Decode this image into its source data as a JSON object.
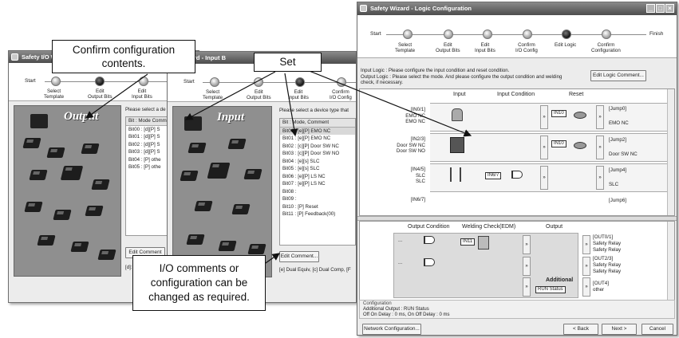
{
  "left_window": {
    "title": "Safety I/O Wi",
    "start": "Start",
    "steps": [
      "Select\nTemplate",
      "Edit\nOutput Bits",
      "Edit\nInput Bits"
    ],
    "image_title": "Output",
    "prompt": "Please select a de",
    "list_header": "Bit : Mode Comm",
    "items": [
      "Bit00 : [d][P] S",
      "Bit01 : [d][P] S",
      "Bit02 : [d][P] S",
      "Bit03 : [d][P] S",
      "Bit04 : [P] othe",
      "Bit05 : [P] othe"
    ],
    "edit_comment": "Edit Comment",
    "legend": "[d]: S"
  },
  "mid_window": {
    "title": "Wizard - Input B",
    "start": "Start",
    "steps": [
      "Select\nTemplate",
      "Edit\nOutput Bits",
      "Edit\nInput Bits",
      "Confirm\nI/O Config"
    ],
    "image_title": "Input",
    "prompt": "Please select a device type that",
    "list_header": "Bit : Mode, Comment",
    "items": [
      "Bit00 : [e][P] EMO NC",
      "Bit01 : [e][P] EMO NC",
      "Bit02 : [c][P] Door SW NC",
      "Bit03 : [c][P] Door SW NO",
      "Bit04 : [e][s] SLC",
      "Bit05 : [e][s] SLC",
      "Bit06 : [e][P] LS NC",
      "Bit07 : [e][P] LS NC",
      "Bit08 :",
      "Bit09 :",
      "Bit10 : [P] Reset",
      "Bit11 : [P] Feedback(00)"
    ],
    "edit_comment": "Edit Comment...",
    "legend": "[e] Dual Equiv, [c] Dual Comp, [F"
  },
  "main_window": {
    "title": "Safety Wizard - Logic Configuration",
    "start": "Start",
    "finish": "Finish",
    "steps": [
      "Select\nTemplate",
      "Edit\nOutput Bits",
      "Edit\nInput Bits",
      "Confirm\nI/O Config",
      "Edit Logic",
      "Confirm\nConfiguration"
    ],
    "info": "Input Logic : Please configure the input condition and reset condition.\nOutput Logic : Please select the mode. And please configure the output condition and welding\ncheck, if necessary.",
    "edit_logic_comment": "Edit Logic Comment...",
    "upper_headers": [
      "Input",
      "Input Condition",
      "Reset"
    ],
    "rows": [
      {
        "label": "[IN0/1]\nEMO NC\nEMO NC",
        "tag": "IN10",
        "jump": "[Jump0]",
        "jump_label": "EMO NC"
      },
      {
        "label": "[IN2/3]\nDoor SW NC\nDoor SW NO",
        "tag": "IN10",
        "jump": "[Jump2]",
        "jump_label": "Door SW NC"
      },
      {
        "label": "[IN4/5]\nSLC\nSLC",
        "tag": "IN6/7",
        "jump": "[Jump4]",
        "jump_label": "SLC"
      },
      {
        "label": "[IN6/7]",
        "jump": "[Jump6]"
      }
    ],
    "lower_headers": [
      "Output Condition",
      "Welding Check(EDM)",
      "Output"
    ],
    "outputs": [
      {
        "label": "[OUT0/1]\nSafety Relay\nSafety Relay",
        "tag": "IN11"
      },
      {
        "label": "[OUT2/3]\nSafety Relay\nSafety Relay"
      },
      {
        "label": "[OUT4]\nother",
        "additional": "Additional",
        "run": "RUN Status"
      }
    ],
    "config_title": "Configuration",
    "config_text": "Additional Output : RUN Status\nOff On Delay : 0 ms, On Off Delay : 0 ms",
    "network": "Network Configuration...",
    "back": "< Back",
    "next": "Next >",
    "cancel": "Cancel",
    "dots": "..."
  },
  "callouts": {
    "confirm": "Confirm configuration\ncontents.",
    "set": "Set",
    "io": "I/O comments or\nconfiguration can be\nchanged as required."
  }
}
